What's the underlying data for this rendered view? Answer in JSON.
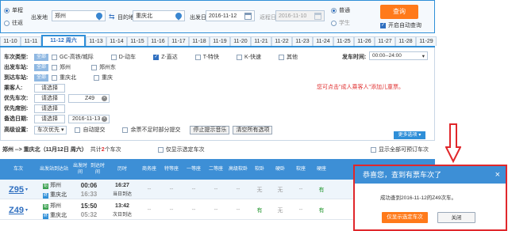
{
  "query": {
    "trip_type": {
      "single": "单程",
      "round": "往返"
    },
    "from_label": "出发地",
    "from_value": "郑州",
    "to_label": "目的地",
    "to_value": "重庆北",
    "date_label": "出发日",
    "date_value": "2016-11-12",
    "return_label": "返程日",
    "return_value": "2016-11-10",
    "ticket_type": {
      "normal": "普通",
      "student": "学生"
    },
    "search_button": "查询",
    "auto_query_label": "开启自动查询"
  },
  "date_tabs": [
    "11-10",
    "11-11",
    "11-12 周六",
    "11-13",
    "11-14",
    "11-15",
    "11-16",
    "11-17",
    "11-18",
    "11-19",
    "11-20",
    "11-21",
    "11-22",
    "11-23",
    "11-24",
    "11-25",
    "11-26",
    "11-27",
    "11-28",
    "11-29"
  ],
  "filters": {
    "train_type_label": "车次类型:",
    "all_tag": "全部",
    "train_types": [
      "GC-高铁/城际",
      "D-动车",
      "Z-直达",
      "T-特快",
      "K-快速",
      "其他"
    ],
    "depart_time_label": "发车时间:",
    "depart_time_value": "00:00--24:00",
    "from_station_label": "出发车站:",
    "from_stations": [
      "郑州",
      "郑州东"
    ],
    "to_station_label": "到达车站:",
    "to_stations": [
      "重庆北",
      "重庆"
    ],
    "passenger_label": "乘客人:",
    "select_btn": "请选择",
    "priority_train_label": "优先车次:",
    "priority_train_value": "Z49",
    "priority_seat_label": "优先席别:",
    "alt_date_label": "备选日期:",
    "alt_date_value": "2016-11-13",
    "advanced_label": "高级设置:",
    "advanced_select": "车次优先",
    "auto_submit": "自动提交",
    "partial_submit": "余票不足时部分提交",
    "stop_sound_btn": "停止提示音乐",
    "clear_btn": "清空所有选项",
    "note": "您可点击\"成人乘客人\"添加儿童票。",
    "more_options": "更多选项"
  },
  "summary": {
    "route": "郑州 --> 重庆北（11月12日 周六）",
    "count_prefix": "共计",
    "count": "2",
    "count_suffix": "个车次",
    "only_selected": "仅显示选定车次",
    "show_all": "显示全部可预订车次"
  },
  "table": {
    "headers": [
      "车次",
      "出发站\n到达站",
      "出发时间\n到达时间",
      "历时",
      "商务座",
      "特等座",
      "一等座",
      "二等座",
      "高级\n软卧",
      "软卧",
      "硬卧",
      "软座",
      "硬座"
    ],
    "rows": [
      {
        "train": "Z95",
        "from": "郑州",
        "to": "重庆北",
        "dep": "00:06",
        "arr": "16:33",
        "dur": "16:27",
        "dur_note": "当日到达",
        "cells": [
          "--",
          "--",
          "--",
          "--",
          "--",
          "无",
          "无",
          "--",
          "有"
        ]
      },
      {
        "train": "Z49",
        "from": "郑州",
        "to": "重庆北",
        "dep": "15:50",
        "arr": "05:32",
        "dur": "13:42",
        "dur_note": "次日到达",
        "cells": [
          "--",
          "--",
          "--",
          "--",
          "--",
          "有",
          "无",
          "--",
          "有"
        ]
      }
    ]
  },
  "dialog": {
    "title": "恭喜您，查到有票车次了",
    "message": "成功查到2016-11-12的Z49次车。",
    "confirm_btn": "仅显示选定车次",
    "close_btn": "关闭"
  },
  "colors": {
    "accent": "#2f8fd8",
    "header_bg": "#3d8fd6",
    "orange": "#ff7a1a",
    "dialog_border": "#e0272b"
  }
}
